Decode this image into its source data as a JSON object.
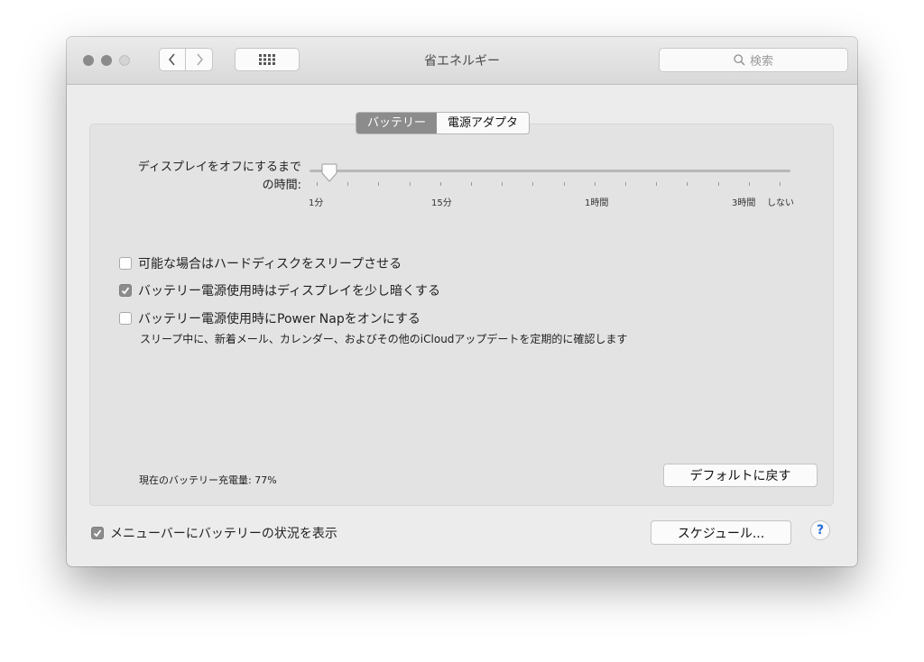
{
  "window": {
    "title": "省エネルギー"
  },
  "search": {
    "placeholder": "検索"
  },
  "tabs": [
    {
      "label": "バッテリー",
      "active": true
    },
    {
      "label": "電源アダプタ",
      "active": false
    }
  ],
  "slider": {
    "label_line1": "ディスプレイをオフにするまで",
    "label_line2": "の時間:",
    "tick_labels": [
      "1分",
      "15分",
      "1時間",
      "3時間",
      "しない"
    ],
    "selected": "1分"
  },
  "options": [
    {
      "label": "可能な場合はハードディスクをスリープさせる",
      "checked": false
    },
    {
      "label": "バッテリー電源使用時はディスプレイを少し暗くする",
      "checked": true
    },
    {
      "label": "バッテリー電源使用時にPower Napをオンにする",
      "checked": false
    }
  ],
  "power_nap_description": "スリープ中に、新着メール、カレンダー、およびその他のiCloudアップデートを定期的に確認します",
  "battery_level_text": "現在のバッテリー充電量: 77%",
  "buttons": {
    "restore_defaults": "デフォルトに戻す",
    "schedule": "スケジュール...",
    "help": "?"
  },
  "menu_bar_option": {
    "label": "メニューバーにバッテリーの状況を表示",
    "checked": true
  },
  "colors": {
    "accent_checkbox": "#8c8c8c",
    "help_blue": "#2a6ed8",
    "active_tab": "#8c8c8c"
  }
}
